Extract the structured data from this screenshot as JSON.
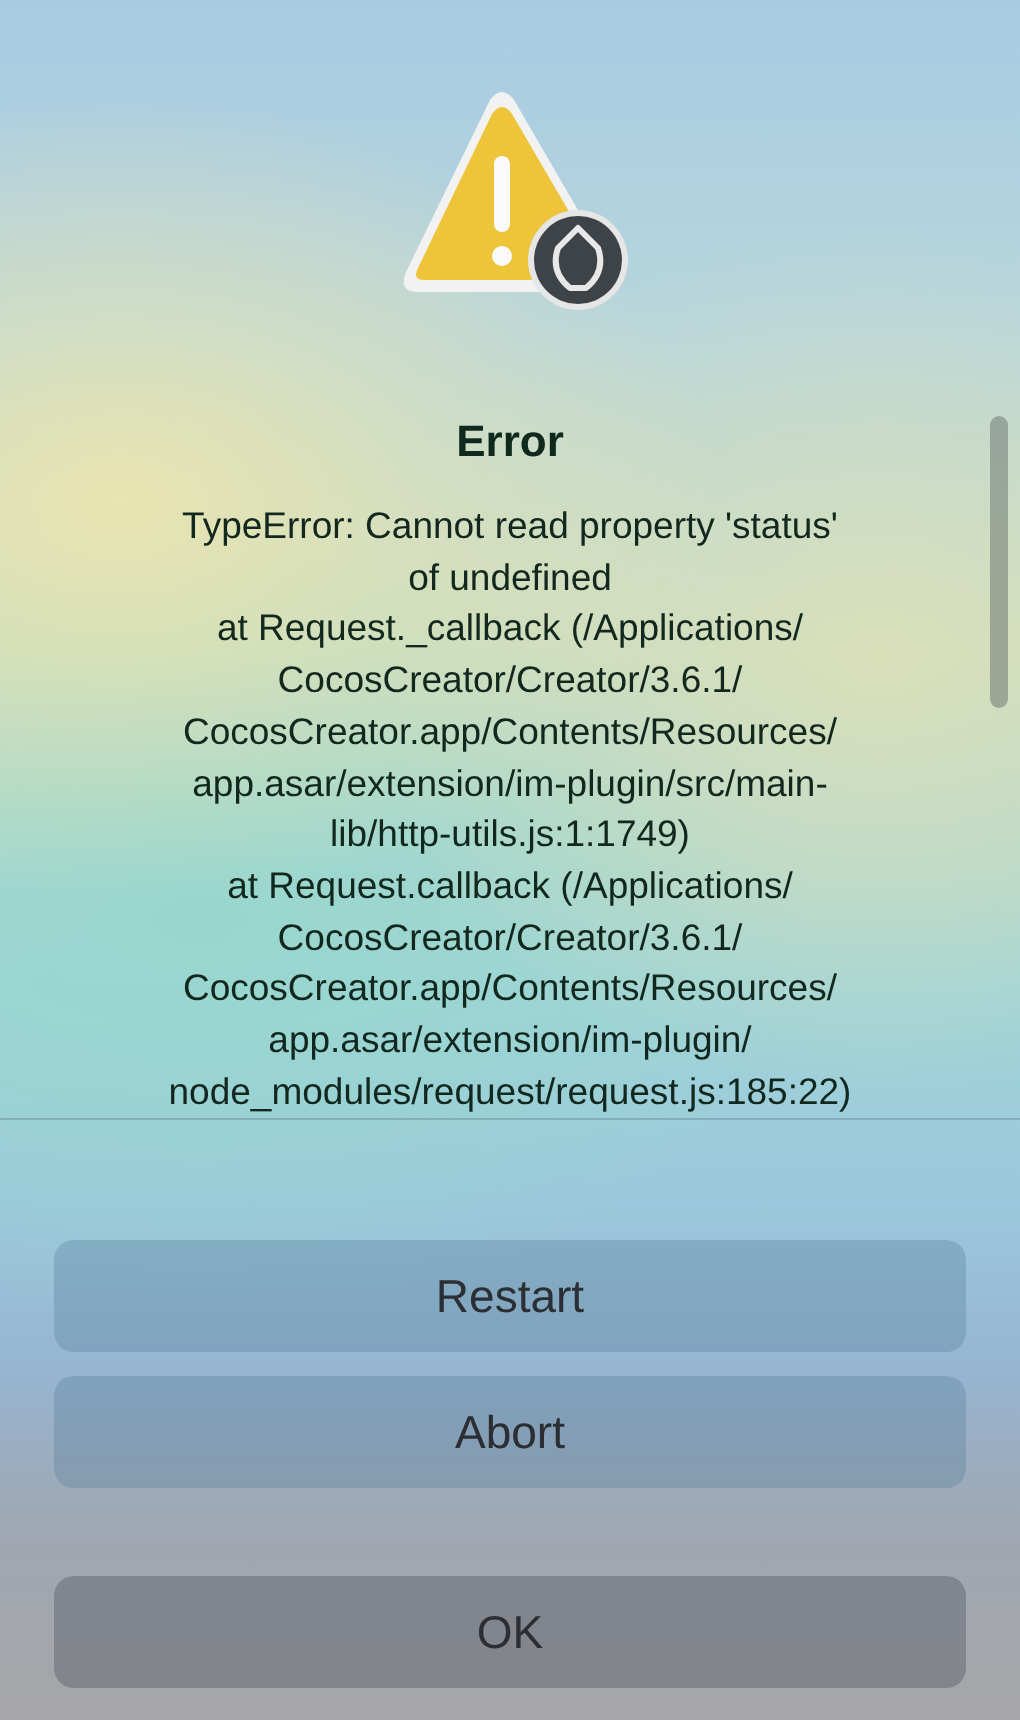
{
  "alert": {
    "title": "Error",
    "message": [
      "TypeError: Cannot read property 'status'",
      "of undefined",
      "at Request._callback (/Applications/",
      "CocosCreator/Creator/3.6.1/",
      "CocosCreator.app/Contents/Resources/",
      "app.asar/extension/im-plugin/src/main-",
      "lib/http-utils.js:1:1749)",
      "at Request.callback (/Applications/",
      "CocosCreator/Creator/3.6.1/",
      "CocosCreator.app/Contents/Resources/",
      "app.asar/extension/im-plugin/",
      "node_modules/request/request.js:185:22)"
    ],
    "buttons": [
      {
        "label": "Restart",
        "kind": "normal"
      },
      {
        "label": "Abort",
        "kind": "normal"
      },
      {
        "label": "OK",
        "kind": "default"
      }
    ]
  }
}
